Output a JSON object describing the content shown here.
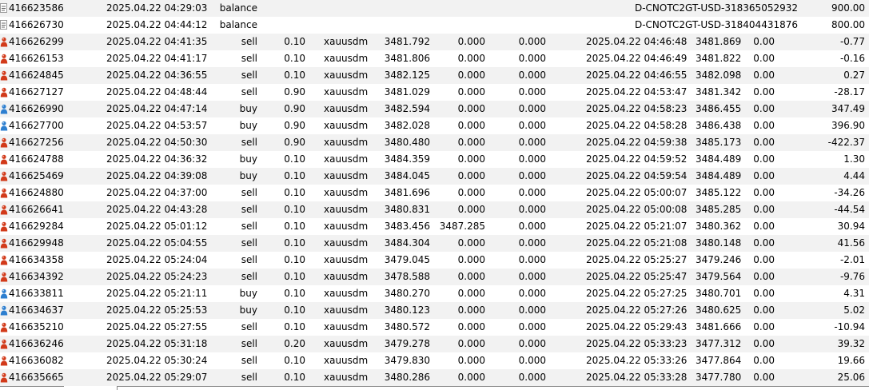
{
  "rows": [
    {
      "id": "416623586",
      "open_time": "2025.04.22 04:29:03",
      "type": "balance",
      "volume": "",
      "symbol": "",
      "open_price": "",
      "sl": "",
      "tp": "",
      "close_time": "",
      "close_price": "",
      "commission": "",
      "swap": "",
      "comment": "D-CNOTC2GT-USD-318365052932",
      "profit": "900.00",
      "icon": "balance-doc-icon"
    },
    {
      "id": "416626730",
      "open_time": "2025.04.22 04:44:12",
      "type": "balance",
      "volume": "",
      "symbol": "",
      "open_price": "",
      "sl": "",
      "tp": "",
      "close_time": "",
      "close_price": "",
      "commission": "",
      "swap": "",
      "comment": "D-CNOTC2GT-USD-318404431876",
      "profit": "800.00",
      "icon": "balance-doc-icon"
    },
    {
      "id": "416626299",
      "open_time": "2025.04.22 04:41:35",
      "type": "sell",
      "volume": "0.10",
      "symbol": "xauusdm",
      "open_price": "3481.792",
      "sl": "0.000",
      "tp": "0.000",
      "close_time": "2025.04.22 04:46:48",
      "close_price": "3481.869",
      "commission": "0.00",
      "swap": "",
      "comment": "",
      "profit": "-0.77",
      "icon": "sell-order-icon"
    },
    {
      "id": "416626153",
      "open_time": "2025.04.22 04:41:17",
      "type": "sell",
      "volume": "0.10",
      "symbol": "xauusdm",
      "open_price": "3481.806",
      "sl": "0.000",
      "tp": "0.000",
      "close_time": "2025.04.22 04:46:49",
      "close_price": "3481.822",
      "commission": "0.00",
      "swap": "",
      "comment": "",
      "profit": "-0.16",
      "icon": "sell-order-icon"
    },
    {
      "id": "416624845",
      "open_time": "2025.04.22 04:36:55",
      "type": "sell",
      "volume": "0.10",
      "symbol": "xauusdm",
      "open_price": "3482.125",
      "sl": "0.000",
      "tp": "0.000",
      "close_time": "2025.04.22 04:46:55",
      "close_price": "3482.098",
      "commission": "0.00",
      "swap": "",
      "comment": "",
      "profit": "0.27",
      "icon": "sell-order-icon"
    },
    {
      "id": "416627127",
      "open_time": "2025.04.22 04:48:44",
      "type": "sell",
      "volume": "0.90",
      "symbol": "xauusdm",
      "open_price": "3481.029",
      "sl": "0.000",
      "tp": "0.000",
      "close_time": "2025.04.22 04:53:47",
      "close_price": "3481.342",
      "commission": "0.00",
      "swap": "",
      "comment": "",
      "profit": "-28.17",
      "icon": "sell-order-icon"
    },
    {
      "id": "416626990",
      "open_time": "2025.04.22 04:47:14",
      "type": "buy",
      "volume": "0.90",
      "symbol": "xauusdm",
      "open_price": "3482.594",
      "sl": "0.000",
      "tp": "0.000",
      "close_time": "2025.04.22 04:58:23",
      "close_price": "3486.455",
      "commission": "0.00",
      "swap": "",
      "comment": "",
      "profit": "347.49",
      "icon": "buy-order-icon"
    },
    {
      "id": "416627700",
      "open_time": "2025.04.22 04:53:57",
      "type": "buy",
      "volume": "0.90",
      "symbol": "xauusdm",
      "open_price": "3482.028",
      "sl": "0.000",
      "tp": "0.000",
      "close_time": "2025.04.22 04:58:28",
      "close_price": "3486.438",
      "commission": "0.00",
      "swap": "",
      "comment": "",
      "profit": "396.90",
      "icon": "buy-order-icon"
    },
    {
      "id": "416627256",
      "open_time": "2025.04.22 04:50:30",
      "type": "sell",
      "volume": "0.90",
      "symbol": "xauusdm",
      "open_price": "3480.480",
      "sl": "0.000",
      "tp": "0.000",
      "close_time": "2025.04.22 04:59:38",
      "close_price": "3485.173",
      "commission": "0.00",
      "swap": "",
      "comment": "",
      "profit": "-422.37",
      "icon": "sell-order-icon"
    },
    {
      "id": "416624788",
      "open_time": "2025.04.22 04:36:32",
      "type": "buy",
      "volume": "0.10",
      "symbol": "xauusdm",
      "open_price": "3484.359",
      "sl": "0.000",
      "tp": "0.000",
      "close_time": "2025.04.22 04:59:52",
      "close_price": "3484.489",
      "commission": "0.00",
      "swap": "",
      "comment": "",
      "profit": "1.30",
      "icon": "sell-order-icon"
    },
    {
      "id": "416625469",
      "open_time": "2025.04.22 04:39:08",
      "type": "buy",
      "volume": "0.10",
      "symbol": "xauusdm",
      "open_price": "3484.045",
      "sl": "0.000",
      "tp": "0.000",
      "close_time": "2025.04.22 04:59:54",
      "close_price": "3484.489",
      "commission": "0.00",
      "swap": "",
      "comment": "",
      "profit": "4.44",
      "icon": "sell-order-icon"
    },
    {
      "id": "416624880",
      "open_time": "2025.04.22 04:37:00",
      "type": "sell",
      "volume": "0.10",
      "symbol": "xauusdm",
      "open_price": "3481.696",
      "sl": "0.000",
      "tp": "0.000",
      "close_time": "2025.04.22 05:00:07",
      "close_price": "3485.122",
      "commission": "0.00",
      "swap": "",
      "comment": "",
      "profit": "-34.26",
      "icon": "sell-order-icon"
    },
    {
      "id": "416626641",
      "open_time": "2025.04.22 04:43:28",
      "type": "sell",
      "volume": "0.10",
      "symbol": "xauusdm",
      "open_price": "3480.831",
      "sl": "0.000",
      "tp": "0.000",
      "close_time": "2025.04.22 05:00:08",
      "close_price": "3485.285",
      "commission": "0.00",
      "swap": "",
      "comment": "",
      "profit": "-44.54",
      "icon": "sell-order-icon"
    },
    {
      "id": "416629284",
      "open_time": "2025.04.22 05:01:12",
      "type": "sell",
      "volume": "0.10",
      "symbol": "xauusdm",
      "open_price": "3483.456",
      "sl": "3487.285",
      "tp": "0.000",
      "close_time": "2025.04.22 05:21:07",
      "close_price": "3480.362",
      "commission": "0.00",
      "swap": "",
      "comment": "",
      "profit": "30.94",
      "icon": "sell-order-icon"
    },
    {
      "id": "416629948",
      "open_time": "2025.04.22 05:04:55",
      "type": "sell",
      "volume": "0.10",
      "symbol": "xauusdm",
      "open_price": "3484.304",
      "sl": "0.000",
      "tp": "0.000",
      "close_time": "2025.04.22 05:21:08",
      "close_price": "3480.148",
      "commission": "0.00",
      "swap": "",
      "comment": "",
      "profit": "41.56",
      "icon": "sell-order-icon"
    },
    {
      "id": "416634358",
      "open_time": "2025.04.22 05:24:04",
      "type": "sell",
      "volume": "0.10",
      "symbol": "xauusdm",
      "open_price": "3479.045",
      "sl": "0.000",
      "tp": "0.000",
      "close_time": "2025.04.22 05:25:27",
      "close_price": "3479.246",
      "commission": "0.00",
      "swap": "",
      "comment": "",
      "profit": "-2.01",
      "icon": "sell-order-icon"
    },
    {
      "id": "416634392",
      "open_time": "2025.04.22 05:24:23",
      "type": "sell",
      "volume": "0.10",
      "symbol": "xauusdm",
      "open_price": "3478.588",
      "sl": "0.000",
      "tp": "0.000",
      "close_time": "2025.04.22 05:25:47",
      "close_price": "3479.564",
      "commission": "0.00",
      "swap": "",
      "comment": "",
      "profit": "-9.76",
      "icon": "sell-order-icon"
    },
    {
      "id": "416633811",
      "open_time": "2025.04.22 05:21:11",
      "type": "buy",
      "volume": "0.10",
      "symbol": "xauusdm",
      "open_price": "3480.270",
      "sl": "0.000",
      "tp": "0.000",
      "close_time": "2025.04.22 05:27:25",
      "close_price": "3480.701",
      "commission": "0.00",
      "swap": "",
      "comment": "",
      "profit": "4.31",
      "icon": "buy-order-icon"
    },
    {
      "id": "416634637",
      "open_time": "2025.04.22 05:25:53",
      "type": "buy",
      "volume": "0.10",
      "symbol": "xauusdm",
      "open_price": "3480.123",
      "sl": "0.000",
      "tp": "0.000",
      "close_time": "2025.04.22 05:27:26",
      "close_price": "3480.625",
      "commission": "0.00",
      "swap": "",
      "comment": "",
      "profit": "5.02",
      "icon": "buy-order-icon"
    },
    {
      "id": "416635210",
      "open_time": "2025.04.22 05:27:55",
      "type": "sell",
      "volume": "0.10",
      "symbol": "xauusdm",
      "open_price": "3480.572",
      "sl": "0.000",
      "tp": "0.000",
      "close_time": "2025.04.22 05:29:43",
      "close_price": "3481.666",
      "commission": "0.00",
      "swap": "",
      "comment": "",
      "profit": "-10.94",
      "icon": "sell-order-icon"
    },
    {
      "id": "416636246",
      "open_time": "2025.04.22 05:31:18",
      "type": "sell",
      "volume": "0.20",
      "symbol": "xauusdm",
      "open_price": "3479.278",
      "sl": "0.000",
      "tp": "0.000",
      "close_time": "2025.04.22 05:33:23",
      "close_price": "3477.312",
      "commission": "0.00",
      "swap": "",
      "comment": "",
      "profit": "39.32",
      "icon": "sell-order-icon"
    },
    {
      "id": "416636082",
      "open_time": "2025.04.22 05:30:24",
      "type": "sell",
      "volume": "0.10",
      "symbol": "xauusdm",
      "open_price": "3479.830",
      "sl": "0.000",
      "tp": "0.000",
      "close_time": "2025.04.22 05:33:26",
      "close_price": "3477.864",
      "commission": "0.00",
      "swap": "",
      "comment": "",
      "profit": "19.66",
      "icon": "sell-order-icon"
    },
    {
      "id": "416635665",
      "open_time": "2025.04.22 05:29:07",
      "type": "sell",
      "volume": "0.10",
      "symbol": "xauusdm",
      "open_price": "3480.286",
      "sl": "0.000",
      "tp": "0.000",
      "close_time": "2025.04.22 05:33:28",
      "close_price": "3477.780",
      "commission": "0.00",
      "swap": "",
      "comment": "",
      "profit": "25.06",
      "icon": "sell-order-icon"
    }
  ],
  "colors": {
    "row_alt": "#f2f2f2",
    "sell_icon": "#d23a1a",
    "buy_icon": "#2d7fd0",
    "doc_icon": "#9a9a9a"
  }
}
